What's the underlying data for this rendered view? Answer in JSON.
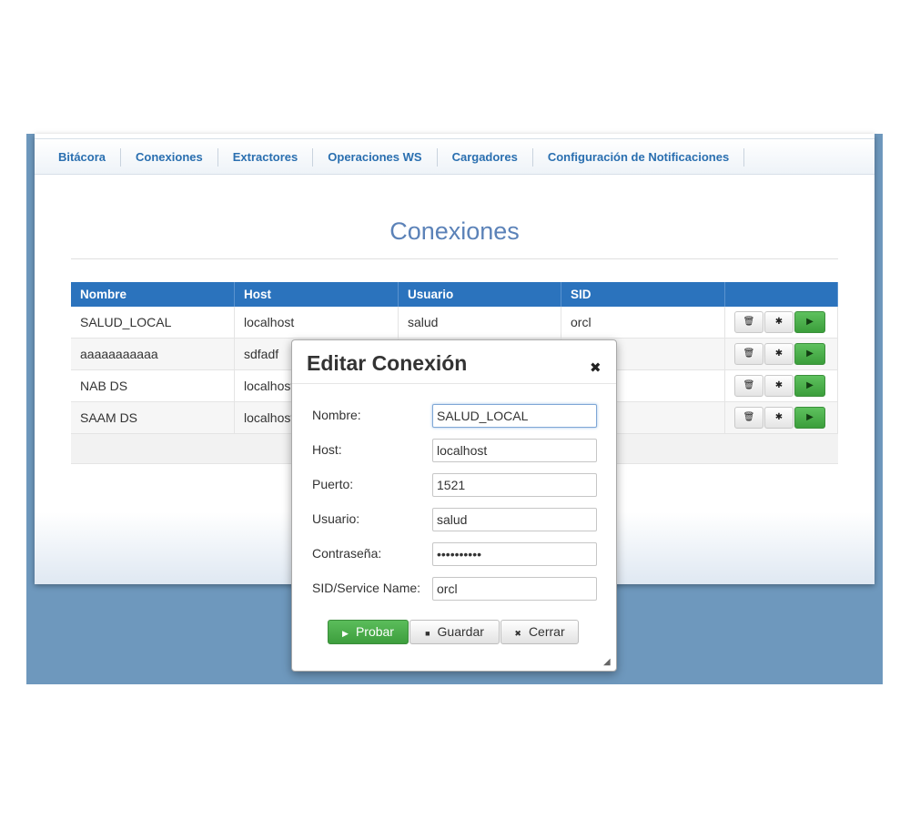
{
  "nav": [
    "Bitácora",
    "Conexiones",
    "Extractores",
    "Operaciones WS",
    "Cargadores",
    "Configuración de Notificaciones"
  ],
  "page_title": "Conexiones",
  "table": {
    "columns": [
      "Nombre",
      "Host",
      "Usuario",
      "SID"
    ],
    "rows": [
      {
        "nombre": "SALUD_LOCAL",
        "host": "localhost",
        "usuario": "salud",
        "sid": "orcl"
      },
      {
        "nombre": "aaaaaaaaaaa",
        "host": "sdfadf",
        "usuario": "",
        "sid": ""
      },
      {
        "nombre": "NAB DS",
        "host": "localhost",
        "usuario": "",
        "sid": ""
      },
      {
        "nombre": "SAAM DS",
        "host": "localhost",
        "usuario": "",
        "sid": ""
      }
    ],
    "row_action_icons": [
      "trash-icon",
      "gear-icon",
      "play-icon"
    ]
  },
  "dialog": {
    "title": "Editar Conexión",
    "close_glyph": "✖",
    "fields": [
      {
        "label": "Nombre:",
        "value": "SALUD_LOCAL"
      },
      {
        "label": "Host:",
        "value": "localhost"
      },
      {
        "label": "Puerto:",
        "value": "1521"
      },
      {
        "label": "Usuario:",
        "value": "salud"
      },
      {
        "label": "Contraseña:",
        "value": "••••••••••"
      },
      {
        "label": "SID/Service Name:",
        "value": "orcl"
      }
    ],
    "buttons": {
      "probar": "Probar",
      "guardar": "Guardar",
      "cerrar": "Cerrar"
    }
  },
  "colors": {
    "backdrop": "#6e98bd",
    "table_header": "#2b73bd",
    "nav_link": "#2a6fb0",
    "title": "#5b82b8",
    "success": "#44a544"
  }
}
